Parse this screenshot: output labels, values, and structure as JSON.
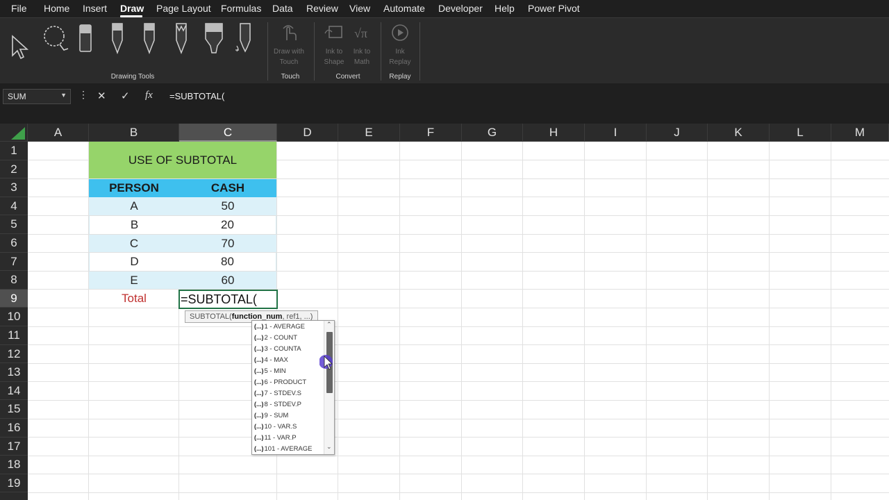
{
  "menu": {
    "items": [
      "File",
      "Home",
      "Insert",
      "Draw",
      "Page Layout",
      "Formulas",
      "Data",
      "Review",
      "View",
      "Automate",
      "Developer",
      "Help",
      "Power Pivot"
    ],
    "active": "Draw"
  },
  "ribbon": {
    "groups": {
      "drawing_tools": "Drawing Tools",
      "touch": "Touch",
      "convert": "Convert",
      "replay": "Replay"
    },
    "draw_with_touch": "Draw with Touch",
    "ink_to_shape": "Ink to Shape",
    "ink_to_math": "Ink to Math",
    "ink_replay": "Ink Replay"
  },
  "formula_bar": {
    "name_box": "SUM",
    "formula": "=SUBTOTAL(",
    "fx_label": "fx"
  },
  "grid": {
    "columns": [
      "A",
      "B",
      "C",
      "D",
      "E",
      "F",
      "G",
      "H",
      "I",
      "J",
      "K",
      "L",
      "M"
    ],
    "selected_column": "C",
    "rows": [
      "1",
      "2",
      "3",
      "4",
      "5",
      "6",
      "7",
      "8",
      "9",
      "10",
      "11",
      "12",
      "13",
      "14",
      "15",
      "16",
      "17",
      "18",
      "19"
    ],
    "selected_row": "9"
  },
  "table": {
    "title": "USE OF SUBTOTAL",
    "headers": [
      "PERSON",
      "CASH"
    ],
    "rows": [
      {
        "person": "A",
        "cash": "50"
      },
      {
        "person": "B",
        "cash": "20"
      },
      {
        "person": "C",
        "cash": "70"
      },
      {
        "person": "D",
        "cash": "80"
      },
      {
        "person": "E",
        "cash": "60"
      }
    ],
    "total_label": "Total",
    "total_value": "=SUBTOTAL("
  },
  "tooltip": {
    "func": "SUBTOTAL(",
    "arg_bold": "function_num",
    "rest": ", ref1, ...)"
  },
  "autocomplete": {
    "icon": "(...)",
    "items": [
      "1 - AVERAGE",
      "2 - COUNT",
      "3 - COUNTA",
      "4 - MAX",
      "5 - MIN",
      "6 - PRODUCT",
      "7 - STDEV.S",
      "8 - STDEV.P",
      "9 - SUM",
      "10 - VAR.S",
      "11 - VAR.P",
      "101 - AVERAGE"
    ]
  },
  "colors": {
    "title_fill": "#96d46a",
    "header_fill": "#3ec0ee",
    "band_fill": "#dcf1f9",
    "total_text": "#c0302f",
    "active_border": "#217346"
  }
}
